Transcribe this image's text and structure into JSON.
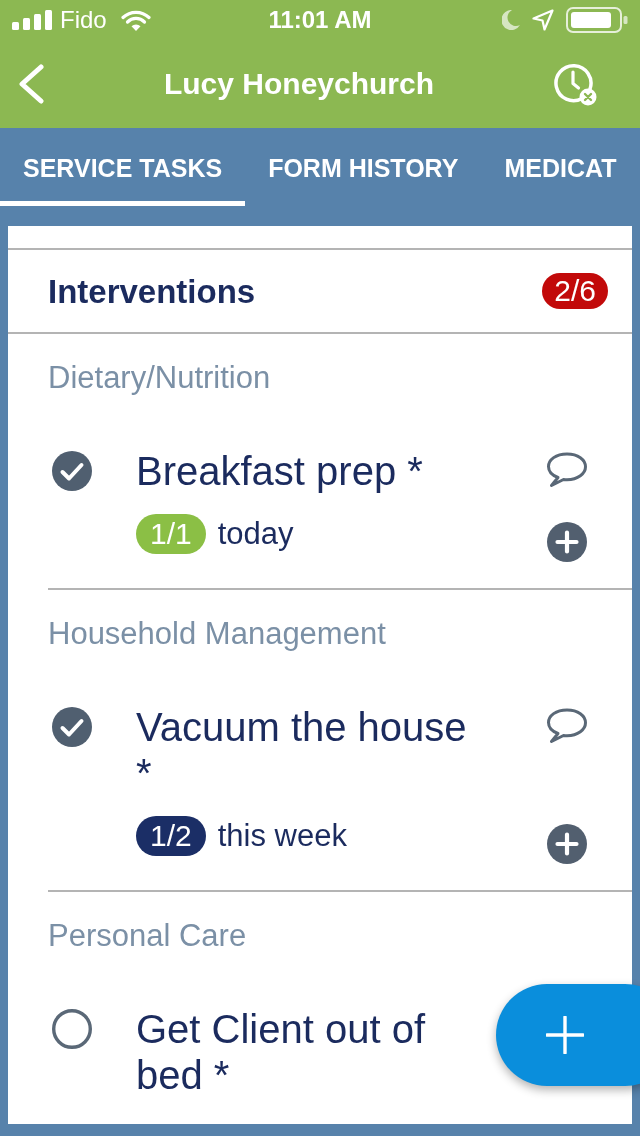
{
  "status_bar": {
    "carrier": "Fido",
    "time": "11:01 AM"
  },
  "nav_bar": {
    "title": "Lucy Honeychurch"
  },
  "tabs": [
    {
      "label": "SERVICE TASKS",
      "selected": true
    },
    {
      "label": "FORM HISTORY",
      "selected": false
    },
    {
      "label": "MEDICAT",
      "selected": false
    }
  ],
  "section": {
    "title": "Interventions",
    "count": "2/6"
  },
  "groups": [
    {
      "category": "Dietary/Nutrition",
      "items": [
        {
          "title": "Breakfast prep *",
          "checked": true,
          "count": "1/1",
          "color": "#8bbf45",
          "frequency": "today"
        }
      ]
    },
    {
      "category": "Household Management",
      "items": [
        {
          "title": "Vacuum the house *",
          "checked": true,
          "count": "1/2",
          "color": "#1b2e66",
          "frequency": "this week"
        }
      ]
    },
    {
      "category": "Personal Care",
      "items": [
        {
          "title": "Get Client out of bed *",
          "checked": false
        }
      ]
    }
  ]
}
